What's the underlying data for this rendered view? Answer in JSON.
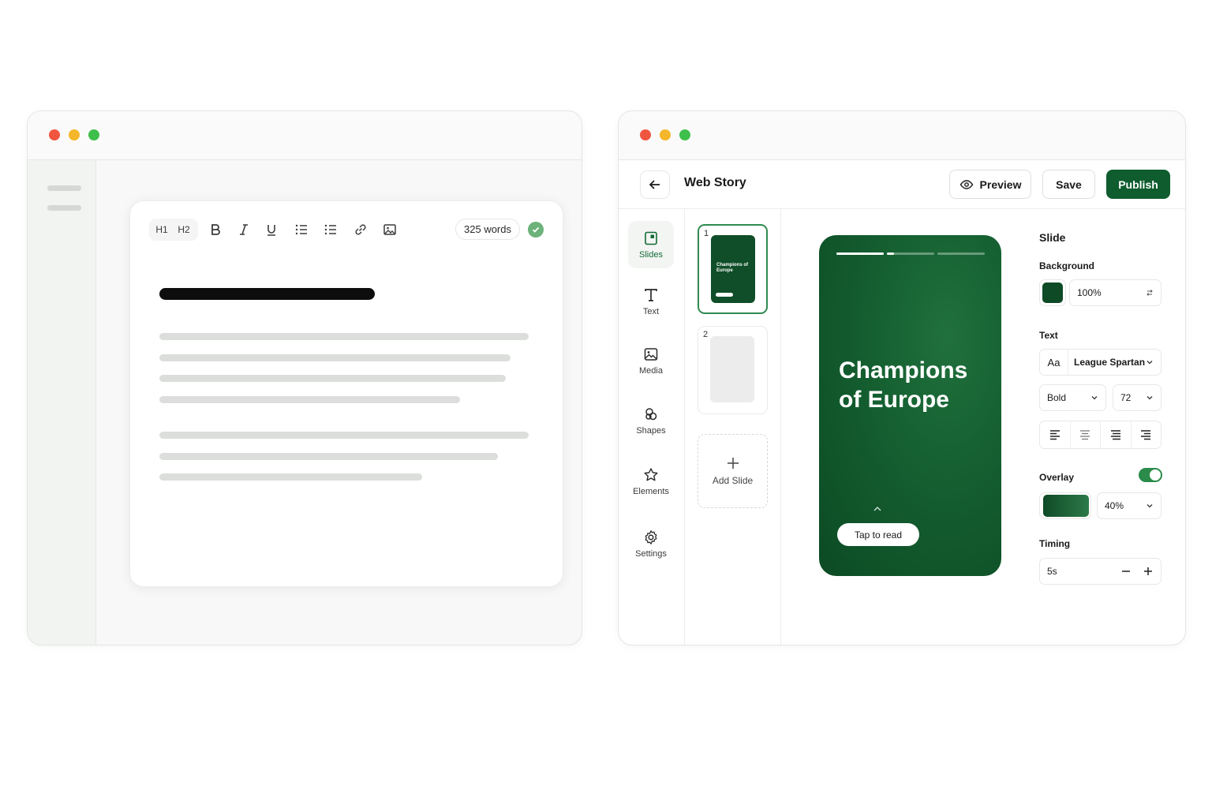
{
  "editor": {
    "toolbar": {
      "h1": "H1",
      "h2": "H2",
      "word_count": "325 words"
    }
  },
  "story_editor": {
    "header": {
      "title": "Web Story",
      "preview_label": "Preview",
      "save_label": "Save",
      "publish_label": "Publish"
    },
    "tools": [
      {
        "label": "Slides",
        "icon": "slides-icon"
      },
      {
        "label": "Text",
        "icon": "text-icon"
      },
      {
        "label": "Media",
        "icon": "image-icon"
      },
      {
        "label": "Shapes",
        "icon": "shapes-icon"
      },
      {
        "label": "Elements",
        "icon": "star-icon"
      },
      {
        "label": "Settings",
        "icon": "gear-icon"
      }
    ],
    "slides": {
      "items": [
        {
          "number": "1",
          "thumb_title": "Champions of Europe"
        },
        {
          "number": "2"
        }
      ],
      "add_label": "Add Slide"
    },
    "preview": {
      "title": "Champions of Europe",
      "cta": "Tap to read",
      "progress": [
        1,
        0.15,
        0
      ]
    },
    "properties": {
      "section_title": "Slide",
      "background_label": "Background",
      "background_color": "#0f4a27",
      "background_opacity": "100%",
      "text_label": "Text",
      "font_prefix": "Aa",
      "font_family": "League Spartan",
      "font_weight": "Bold",
      "font_size": "72",
      "overlay_label": "Overlay",
      "overlay_enabled": true,
      "overlay_opacity": "40%",
      "timing_label": "Timing",
      "timing_value": "5s"
    }
  },
  "colors": {
    "accent": "#0f5c2e",
    "toggle": "#2a8b4a",
    "check": "#6cb27a"
  }
}
